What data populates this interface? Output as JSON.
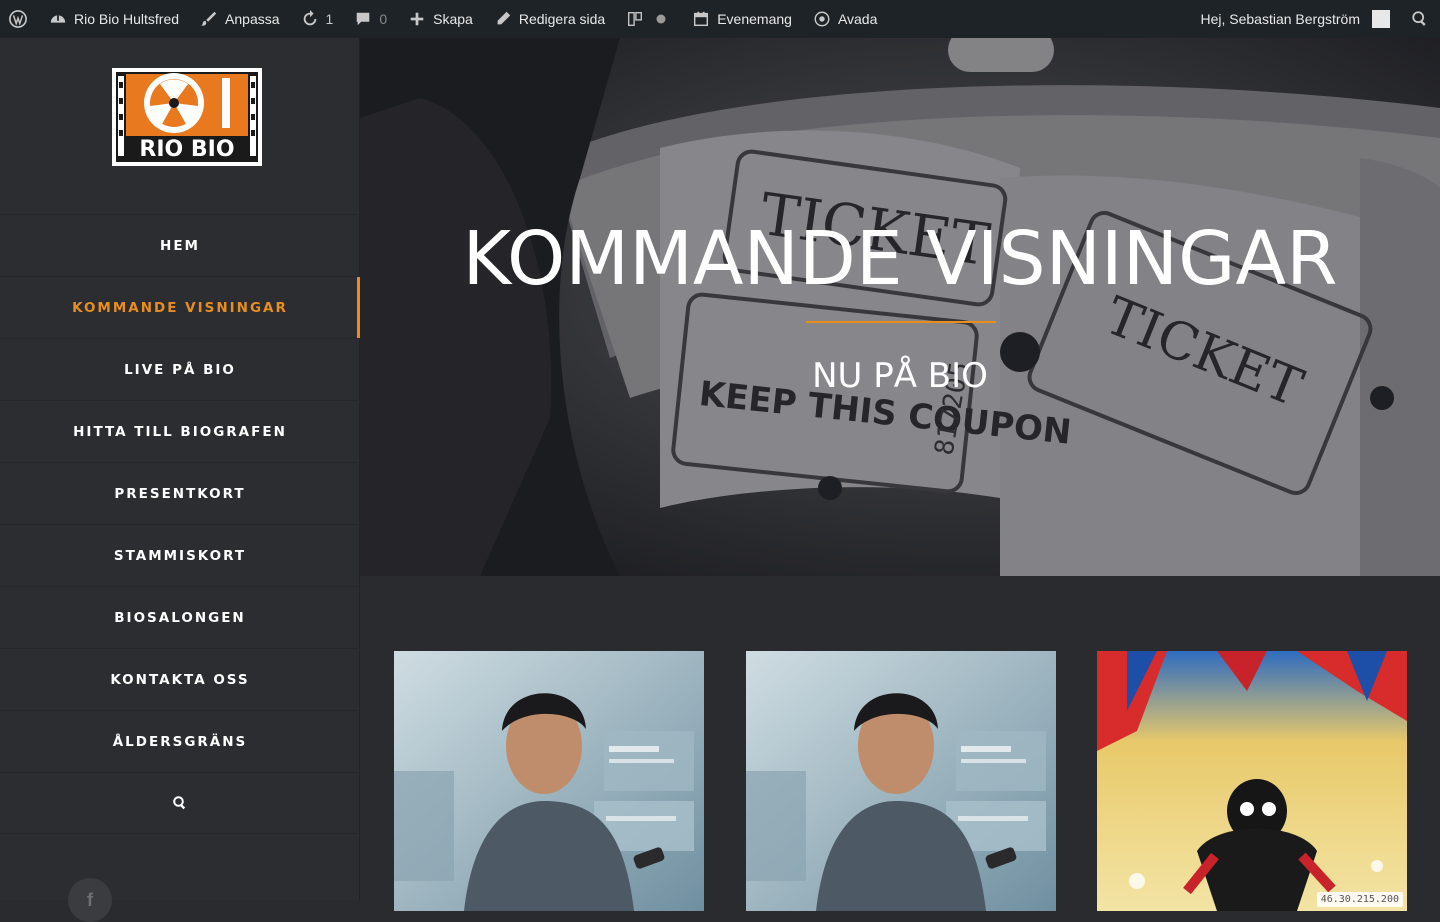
{
  "adminbar": {
    "wp_logo": "wordpress-icon",
    "site_name": "Rio Bio Hultsfred",
    "customize": "Anpassa",
    "updates_count": "1",
    "comments_count": "0",
    "new": "Skapa",
    "edit_page": "Redigera sida",
    "events": "Evenemang",
    "avada": "Avada",
    "greeting": "Hej, Sebastian Bergström"
  },
  "logo": {
    "text": "RIO BIO"
  },
  "menu": {
    "items": [
      {
        "label": "HEM"
      },
      {
        "label": "KOMMANDE VISNINGAR"
      },
      {
        "label": "LIVE PÅ BIO"
      },
      {
        "label": "HITTA TILL BIOGRAFEN"
      },
      {
        "label": "PRESENTKORT"
      },
      {
        "label": "STAMMISKORT"
      },
      {
        "label": "BIOSALONGEN"
      },
      {
        "label": "KONTAKTA OSS"
      },
      {
        "label": "ÅLDERSGRÄNS"
      }
    ],
    "active_index": 1
  },
  "hero": {
    "title": "KOMMANDE VISNINGAR",
    "subtitle": "NU PÅ BIO",
    "ticket_text": "TICKET",
    "coupon_text": "KEEP THIS COUPON",
    "serial": "817205"
  },
  "posters": {
    "ip_badge": "46.30.215.200"
  },
  "colors": {
    "accent": "#e88e1f",
    "adminbar_bg": "#1d2327",
    "sidebar_bg": "#2b2d30",
    "content_bg": "#2a2b2e"
  }
}
